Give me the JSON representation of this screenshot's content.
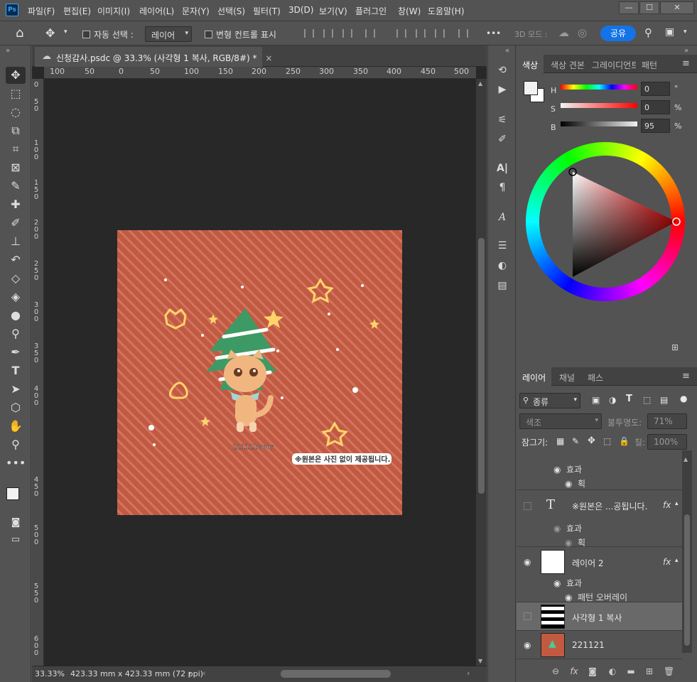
{
  "menubar": {
    "logo": "Ps",
    "items": [
      "파일(F)",
      "편집(E)",
      "이미지(I)",
      "레이어(L)",
      "문자(Y)",
      "선택(S)",
      "필터(T)",
      "3D(D)",
      "보기(V)",
      "플러그인",
      "창(W)",
      "도움말(H)"
    ],
    "win_min": "—",
    "win_max": "☐",
    "win_close": "✕"
  },
  "options": {
    "auto_select": "자동 선택 :",
    "auto_select_target": "레이어",
    "transform_controls": "변형 컨트롤 표시",
    "more": "•••",
    "mode_3d": "3D 모드 :",
    "share": "공유"
  },
  "document": {
    "tab_title": "신청감사.psdc @ 33.3% (사각형 1 복사, RGB/8#) *",
    "close": "×",
    "hruler_ticks": [
      "100",
      "50",
      "0",
      "50",
      "100",
      "150",
      "200",
      "250",
      "300",
      "350",
      "400",
      "450",
      "500"
    ],
    "vruler_ticks": [
      "0",
      "5 0",
      "1 0 0",
      "1 5 0",
      "2 0 0",
      "2 5 0",
      "3 0 0",
      "3 5 0",
      "4 0 0",
      "4 5 0",
      "5 0 0",
      "5 5 0",
      "6 0 0"
    ],
    "canvas_caption": "221121woon",
    "canvas_notice": "※원본은 사진 없이 제공됩니다."
  },
  "status": {
    "zoom": "33.33%",
    "info": "423.33 mm x 423.33 mm (72 ppi)",
    "arrow": "›"
  },
  "color_panel": {
    "tabs": [
      "색상",
      "색상 견본",
      "그레이디언트",
      "패턴"
    ],
    "h_label": "H",
    "h_value": "0",
    "h_unit": "°",
    "s_label": "S",
    "s_value": "0",
    "s_unit": "%",
    "b_label": "B",
    "b_value": "95",
    "b_unit": "%"
  },
  "layers_panel": {
    "tabs": [
      "레이어",
      "채널",
      "패스"
    ],
    "filter": "종류",
    "blend_mode": "색조",
    "opacity_label": "불투명도:",
    "opacity_value": "71%",
    "lock_label": "잠그기:",
    "fill_label": "칠:",
    "fill_value": "100%",
    "effects_label": "효과",
    "stroke_label": "획",
    "pattern_overlay_label": "패턴 오버레이",
    "layers": [
      {
        "name": "※원본은 ...공됩니다."
      },
      {
        "name": "레이어 2"
      },
      {
        "name": "사각형 1 복사"
      },
      {
        "name": "221121"
      }
    ],
    "fx": "fx"
  },
  "colors": {
    "accent": "#1473e6",
    "canvas_bg": "#c25a42",
    "ui_bg": "#535353"
  }
}
